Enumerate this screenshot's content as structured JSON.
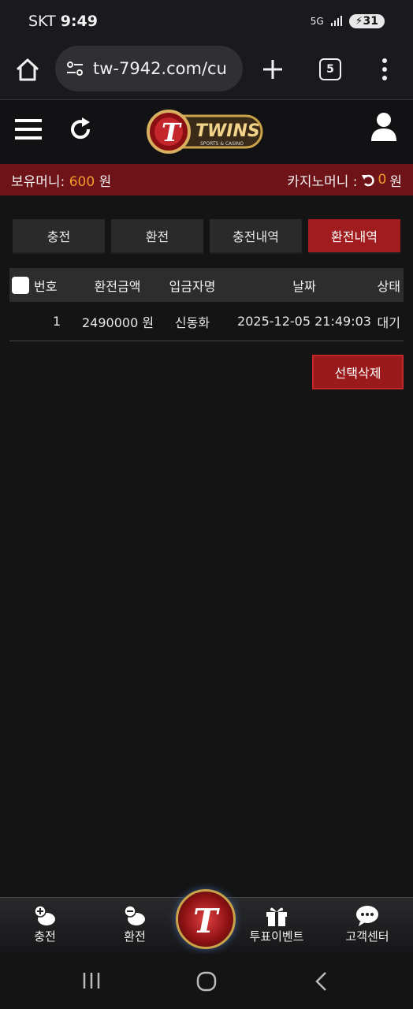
{
  "status_bar": {
    "carrier": "SKT",
    "time": "9:49",
    "network": "5G",
    "battery": "31"
  },
  "browser": {
    "url": "tw-7942.com/cu",
    "tab_count": "5"
  },
  "site": {
    "logo_text": "TWINS",
    "logo_subtext": "SPORTS & CASINO"
  },
  "money_bar": {
    "holding_label": "보유머니:",
    "holding_amount": "600",
    "holding_unit": "원",
    "casino_label": "카지노머니 :",
    "casino_amount": "0",
    "casino_unit": "원"
  },
  "tabs": [
    {
      "label": "충전",
      "active": false
    },
    {
      "label": "환전",
      "active": false
    },
    {
      "label": "충전내역",
      "active": false
    },
    {
      "label": "환전내역",
      "active": true
    }
  ],
  "table": {
    "headers": {
      "num": "번호",
      "amount": "환전금액",
      "depositor": "입금자명",
      "date": "날짜",
      "status": "상태"
    },
    "rows": [
      {
        "num": "1",
        "amount": "2490000 원",
        "depositor": "신동화",
        "date": "2025-12-05 21:49:03",
        "status": "대기"
      }
    ]
  },
  "delete_button": "선택삭제",
  "bottom_nav": {
    "charge": "충전",
    "exchange": "환전",
    "event": "투표이벤트",
    "support": "고객센터"
  },
  "colors": {
    "accent": "#a01c1e",
    "money_bar": "#6e1318",
    "amount": "#f39b2a"
  }
}
